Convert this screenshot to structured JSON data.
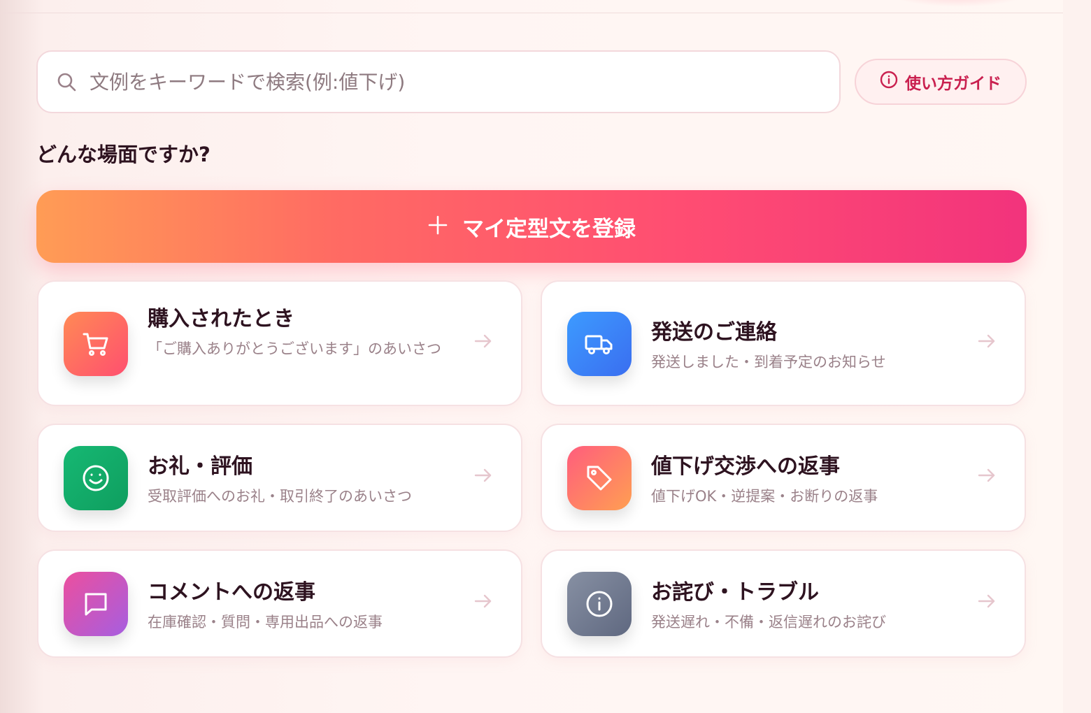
{
  "search": {
    "placeholder": "文例をキーワードで検索(例:値下げ)"
  },
  "guide_button": {
    "label": "使い方ガイド"
  },
  "section_title": "どんな場面ですか?",
  "register_button": {
    "label": "マイ定型文を登録"
  },
  "categories": [
    {
      "title": "購入されたとき",
      "desc": "「ご購入ありがとうございます」のあいさつ",
      "icon": "cart-icon"
    },
    {
      "title": "発送のご連絡",
      "desc": "発送しました・到着予定のお知らせ",
      "icon": "truck-icon"
    },
    {
      "title": "お礼・評価",
      "desc": "受取評価へのお礼・取引終了のあいさつ",
      "icon": "smile-icon"
    },
    {
      "title": "値下げ交渉への返事",
      "desc": "値下げOK・逆提案・お断りの返事",
      "icon": "tag-icon"
    },
    {
      "title": "コメントへの返事",
      "desc": "在庫確認・質問・専用出品への返事",
      "icon": "chat-icon"
    },
    {
      "title": "お詫び・トラブル",
      "desc": "発送遅れ・不備・返信遅れのお詫び",
      "icon": "info-icon"
    }
  ],
  "colors": {
    "accent": "#f2337c",
    "guide_text": "#c9204f"
  }
}
